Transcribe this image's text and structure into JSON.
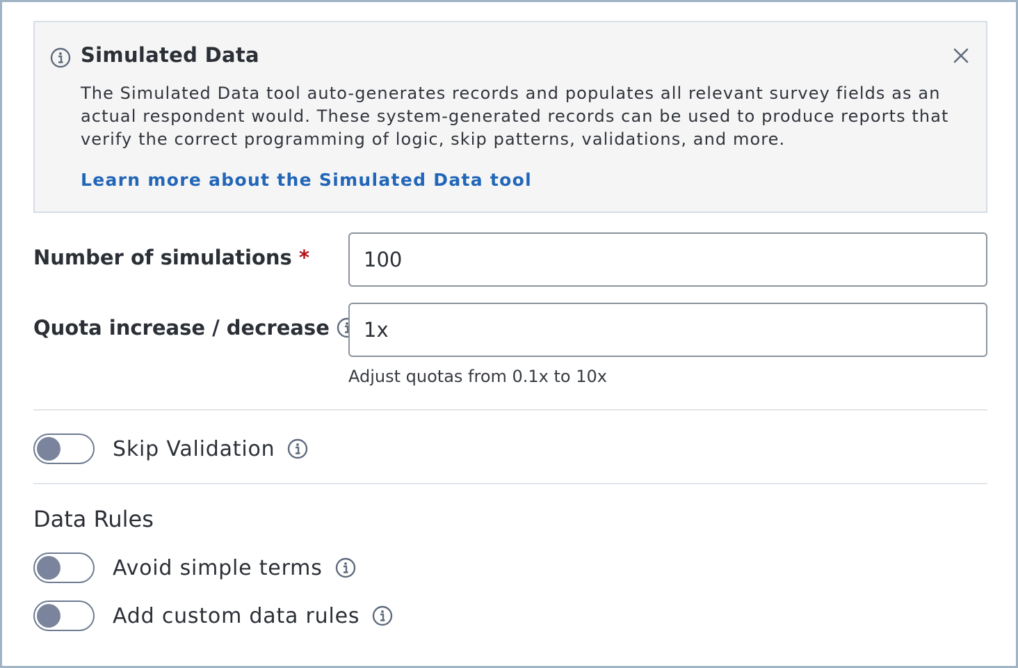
{
  "banner": {
    "title": "Simulated Data",
    "description": "The Simulated Data tool auto-generates records and populates all relevant survey fields as an actual respondent would. These system-generated records can be used to produce reports that verify the correct programming of logic, skip patterns, validations, and more.",
    "link": "Learn more about the Simulated Data tool",
    "icon": "info-icon",
    "close_icon": "close-icon"
  },
  "form": {
    "simulations": {
      "label": "Number of simulations",
      "required_mark": "*",
      "value": "100"
    },
    "quota": {
      "label": "Quota increase / decrease",
      "value": "1x",
      "hint": "Adjust quotas from 0.1x to 10x"
    }
  },
  "toggles": {
    "skip_validation": {
      "label": "Skip Validation",
      "on": false
    }
  },
  "data_rules": {
    "title": "Data Rules",
    "avoid_simple_terms": {
      "label": "Avoid simple terms",
      "on": false
    },
    "custom_rules": {
      "label": "Add custom data rules",
      "on": false
    }
  },
  "colors": {
    "link": "#2266b8",
    "required": "#b3121a",
    "toggle_knob": "#7a849c",
    "banner_bg": "#f5f5f6"
  }
}
